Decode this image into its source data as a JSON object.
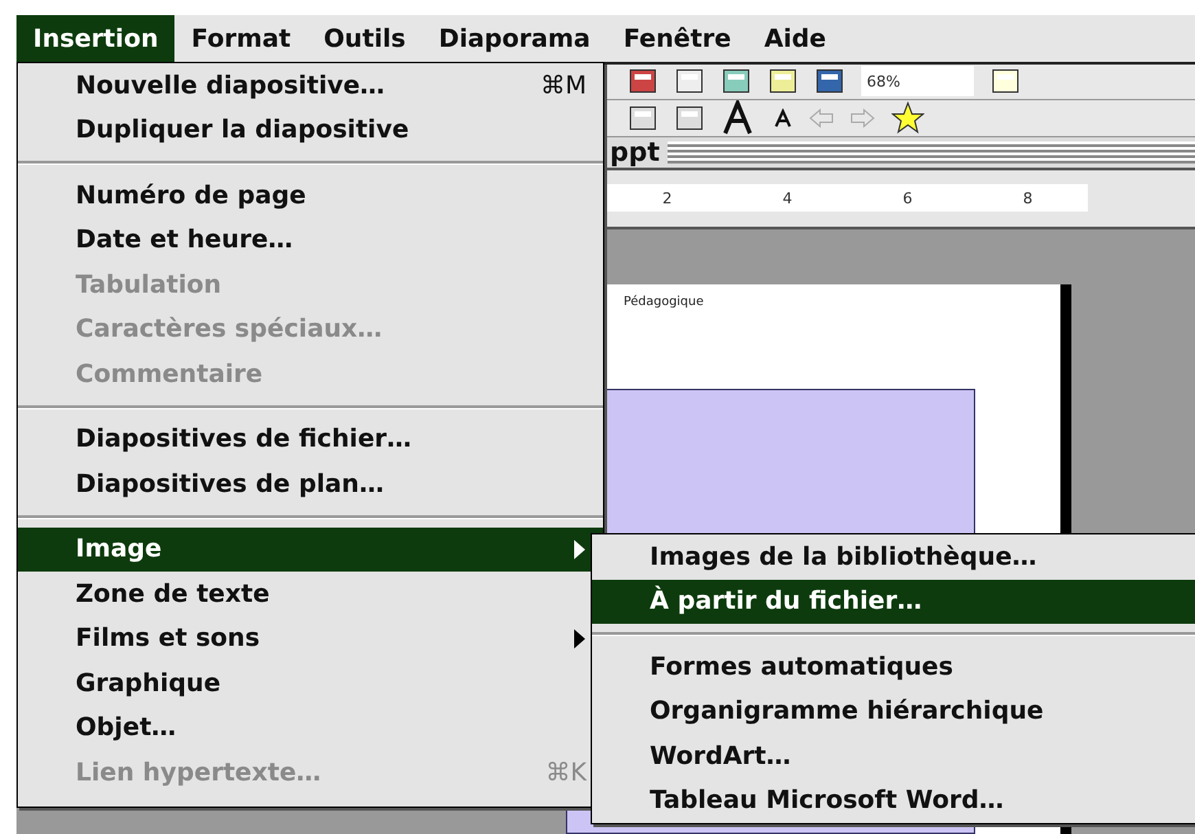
{
  "menubar": [
    {
      "label": "Insertion",
      "selected": true
    },
    {
      "label": "Format",
      "selected": false
    },
    {
      "label": "Outils",
      "selected": false
    },
    {
      "label": "Diaporama",
      "selected": false
    },
    {
      "label": "Fenêtre",
      "selected": false
    },
    {
      "label": "Aide",
      "selected": false
    }
  ],
  "menu": {
    "groups": [
      [
        {
          "label": "Nouvelle diapositive…",
          "shortcut": "⌘M",
          "disabled": false,
          "submenu": false,
          "selected": false
        },
        {
          "label": "Dupliquer la diapositive",
          "disabled": false,
          "submenu": false,
          "selected": false
        }
      ],
      [
        {
          "label": "Numéro de page",
          "disabled": false,
          "submenu": false,
          "selected": false
        },
        {
          "label": "Date et heure…",
          "disabled": false,
          "submenu": false,
          "selected": false
        },
        {
          "label": "Tabulation",
          "disabled": true,
          "submenu": false,
          "selected": false
        },
        {
          "label": "Caractères spéciaux…",
          "disabled": true,
          "submenu": false,
          "selected": false
        },
        {
          "label": "Commentaire",
          "disabled": true,
          "submenu": false,
          "selected": false
        }
      ],
      [
        {
          "label": "Diapositives de fichier…",
          "disabled": false,
          "submenu": false,
          "selected": false
        },
        {
          "label": "Diapositives de plan…",
          "disabled": false,
          "submenu": false,
          "selected": false
        }
      ],
      [
        {
          "label": "Image",
          "disabled": false,
          "submenu": true,
          "selected": true
        },
        {
          "label": "Zone de texte",
          "disabled": false,
          "submenu": false,
          "selected": false
        },
        {
          "label": "Films et sons",
          "disabled": false,
          "submenu": true,
          "selected": false
        },
        {
          "label": "Graphique",
          "disabled": false,
          "submenu": false,
          "selected": false
        },
        {
          "label": "Objet…",
          "disabled": false,
          "submenu": false,
          "selected": false
        },
        {
          "label": "Lien hypertexte…",
          "shortcut": "⌘K",
          "disabled": true,
          "submenu": false,
          "selected": false
        }
      ]
    ]
  },
  "submenu": {
    "groups": [
      [
        {
          "label": "Images de la bibliothèque…",
          "selected": false
        },
        {
          "label": "À partir du fichier…",
          "selected": true
        }
      ],
      [
        {
          "label": "Formes automatiques",
          "selected": false
        },
        {
          "label": "Organigramme hiérarchique",
          "selected": false
        },
        {
          "label": "WordArt…",
          "selected": false
        },
        {
          "label": "Tableau Microsoft Word…",
          "selected": false
        }
      ]
    ]
  },
  "toolbar": {
    "zoom": "68%"
  },
  "document": {
    "title": "ppt",
    "ruler": [
      "2",
      "4",
      "6",
      "8"
    ],
    "slide_text": "Pédagogique"
  }
}
